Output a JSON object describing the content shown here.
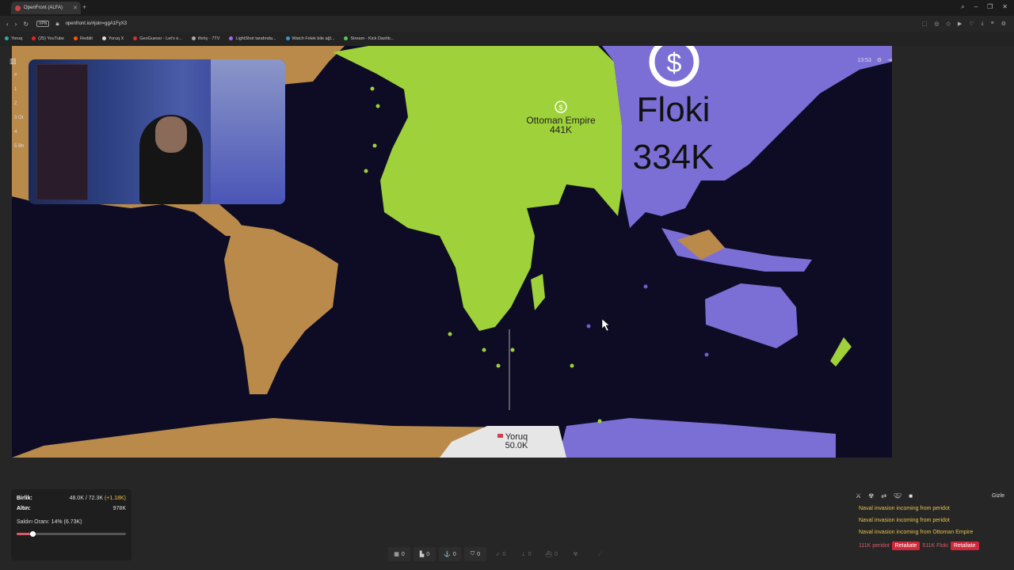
{
  "browser": {
    "tab_title": "OpenFront (ALFA)",
    "url": "openfront.io/#join=ggA1FyX3",
    "vpn_label": "VPN",
    "bookmarks": [
      {
        "label": "Yoruq",
        "color": "#3a9"
      },
      {
        "label": "(25) YouTube",
        "color": "#e22"
      },
      {
        "label": "Reddit",
        "color": "#f50"
      },
      {
        "label": "Yoruq X",
        "color": "#ddd"
      },
      {
        "label": "GeoGuessr - Let's e...",
        "color": "#c33"
      },
      {
        "label": "ifixhy - 7TV",
        "color": "#aaa"
      },
      {
        "label": "LightShot tarafında...",
        "color": "#a6e"
      },
      {
        "label": "Watch Felek bile ağl...",
        "color": "#39c"
      },
      {
        "label": "Stream - Kick Dashb...",
        "color": "#5c5"
      }
    ]
  },
  "leaderboard": {
    "header": "#",
    "rows": [
      "1",
      "2",
      "3  Ot",
      "4",
      "5  Bh"
    ]
  },
  "game": {
    "clock": "13:53",
    "players": [
      {
        "name": "Floki",
        "troops": "334K",
        "color": "#7b6fd6"
      },
      {
        "name": "Ottoman Empire",
        "troops": "441K",
        "color": "#9fd13a"
      },
      {
        "name": "Yoruq",
        "troops": "50.0K",
        "color": "#e6e6e6"
      }
    ],
    "colors": {
      "ocean": "#0d0c24",
      "neutral": "#b98a4a",
      "floki": "#7b6fd6",
      "ottoman": "#9fd13a"
    }
  },
  "stats": {
    "troops_label": "Birlik:",
    "troops_value": "48.0K / 72.3K",
    "troops_gain": "(+1.18K)",
    "gold_label": "Altın:",
    "gold_value": "978K",
    "attack_ratio": "Saldırı Oranı: 14% (6.73K)",
    "attack_ratio_fraction": 0.14
  },
  "toolbar": [
    {
      "icon": "city-icon",
      "count": "0"
    },
    {
      "icon": "factory-icon",
      "count": "0"
    },
    {
      "icon": "port-icon",
      "count": "0"
    },
    {
      "icon": "defense-icon",
      "count": "0"
    },
    {
      "icon": "missile-icon",
      "count": "0"
    },
    {
      "icon": "sam-icon",
      "count": "0"
    },
    {
      "icon": "warship-icon",
      "count": "0"
    },
    {
      "icon": "nuke-icon",
      "count": ""
    },
    {
      "icon": "hydrogen-bomb-icon",
      "count": ""
    }
  ],
  "events": {
    "hide_label": "Gizle",
    "messages": [
      "Naval invasion incoming from peridot",
      "Naval invasion incoming from peridot",
      "Naval invasion incoming from Ottoman Empire"
    ],
    "retaliate": [
      {
        "label": "111K peridot",
        "button": "Retaliate"
      },
      {
        "label": "511K Floki",
        "button": "Retaliate"
      }
    ]
  }
}
